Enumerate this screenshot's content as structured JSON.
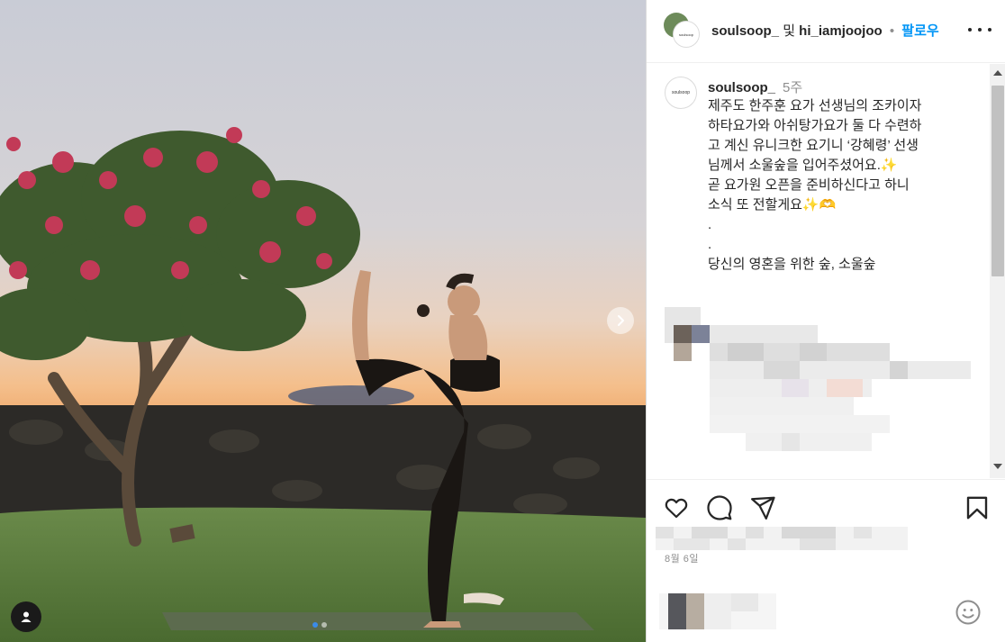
{
  "post": {
    "media_alt": "Yoga dancer pose photo at sunset",
    "carousel": {
      "count": 2,
      "active": 0
    }
  },
  "header": {
    "user1": "soulsoop_",
    "conjunction": "및",
    "user2": "hi_iamjoojoo",
    "separator": "•",
    "follow_label": "팔로우",
    "avatar_text": "soulsoop"
  },
  "caption": {
    "username": "soulsoop_",
    "time": "5주",
    "avatar_text": "soulsoop",
    "text": "제주도 한주훈 요가 선생님의 조카이자\n하타요가와 아쉬탕가요가 둘 다 수련하\n고 계신 유니크한 요기니 ‘강혜령’ 선생\n님께서 소울숲을 입어주셨어요.✨\n곧 요가원 오픈을 준비하신다고 하니\n소식 또 전할게요✨🫶\n.\n.\n당신의 영혼을 위한 숲, 소울숲"
  },
  "meta": {
    "date": "8월 6일"
  },
  "icons": {
    "like": "heart-icon",
    "comment": "comment-icon",
    "share": "paper-plane-icon",
    "save": "bookmark-icon",
    "emoji": "emoji-icon",
    "more": "more-horizontal-icon",
    "next": "chevron-right-icon",
    "user_tag": "user-icon"
  },
  "colors": {
    "follow": "#0095f6",
    "text": "#262626",
    "muted": "#8e8e8e",
    "carousel_active": "#3b8bea"
  }
}
